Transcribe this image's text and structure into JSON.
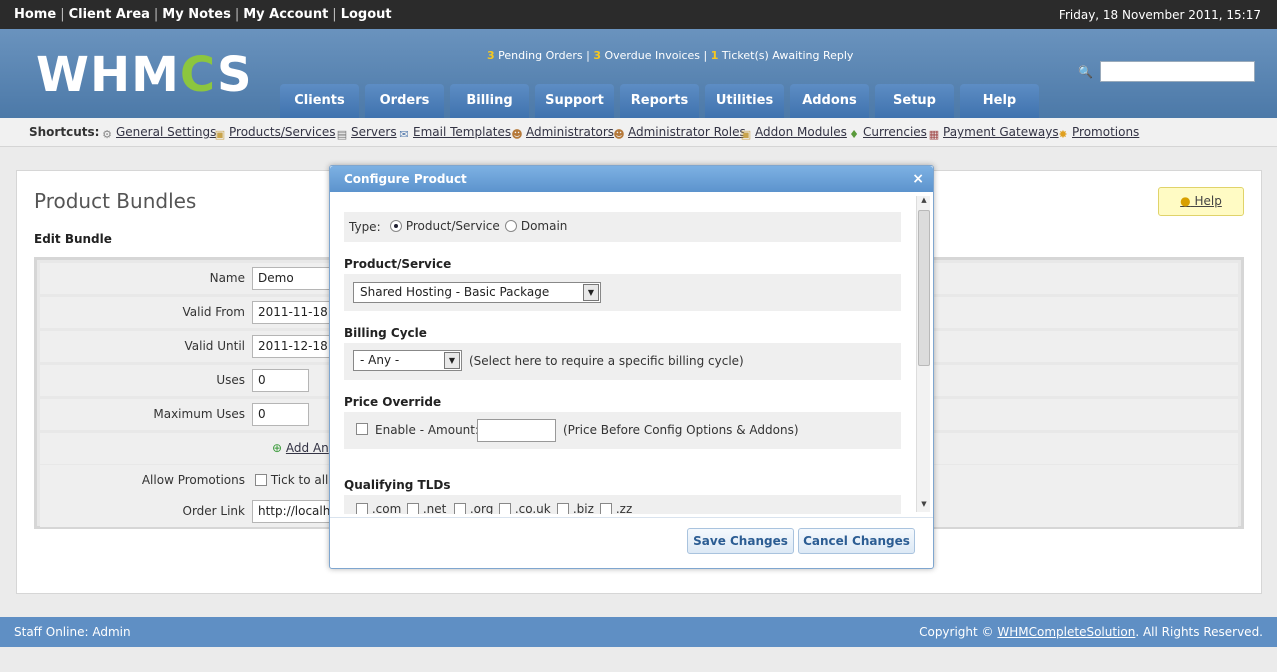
{
  "topbar": {
    "links": [
      "Home",
      "Client Area",
      "My Notes",
      "My Account",
      "Logout"
    ],
    "date": "Friday, 18 November 2011, 15:17"
  },
  "header": {
    "logo_left": "WHM",
    "logo_gear": "C",
    "logo_right": "S",
    "notices": {
      "pending_count": "3",
      "pending_label": "Pending Orders",
      "overdue_count": "3",
      "overdue_label": "Overdue Invoices",
      "tickets_count": "1",
      "tickets_label": "Ticket(s) Awaiting Reply"
    },
    "search_value": "",
    "nav": [
      "Clients",
      "Orders",
      "Billing",
      "Support",
      "Reports",
      "Utilities",
      "Addons",
      "Setup",
      "Help"
    ]
  },
  "shortcuts": {
    "label": "Shortcuts:",
    "items": [
      {
        "label": "General Settings",
        "icon": "gear-icon"
      },
      {
        "label": "Products/Services",
        "icon": "box-icon"
      },
      {
        "label": "Servers",
        "icon": "server-icon"
      },
      {
        "label": "Email Templates",
        "icon": "email-icon"
      },
      {
        "label": "Administrators",
        "icon": "user-icon"
      },
      {
        "label": "Administrator Roles",
        "icon": "user-role-icon"
      },
      {
        "label": "Addon Modules",
        "icon": "module-icon"
      },
      {
        "label": "Currencies",
        "icon": "money-icon"
      },
      {
        "label": "Payment Gateways",
        "icon": "gateway-icon"
      },
      {
        "label": "Promotions",
        "icon": "star-icon"
      }
    ]
  },
  "page": {
    "title": "Product Bundles",
    "section": "Edit Bundle",
    "help": "Help",
    "form": {
      "name_label": "Name",
      "name_value": "Demo",
      "valid_from_label": "Valid From",
      "valid_from_value": "2011-11-18",
      "valid_until_label": "Valid Until",
      "valid_until_value": "2011-12-18",
      "uses_label": "Uses",
      "uses_value": "0",
      "max_uses_label": "Maximum Uses",
      "max_uses_value": "0",
      "add_another": "Add An",
      "allow_promotions_label": "Allow Promotions",
      "allow_promotions_text": "Tick to allo",
      "order_link_label": "Order Link",
      "order_link_value": "http://localho"
    }
  },
  "modal": {
    "title": "Configure Product",
    "close": "×",
    "type_label": "Type:",
    "type_options": [
      "Product/Service",
      "Domain"
    ],
    "product_heading": "Product/Service",
    "product_value": "Shared Hosting - Basic Package",
    "billing_heading": "Billing Cycle",
    "billing_value": "- Any -",
    "billing_hint": "(Select here to require a specific billing cycle)",
    "price_heading": "Price Override",
    "price_label": "Enable - Amount:",
    "price_value": "",
    "price_hint": "(Price Before Config Options & Addons)",
    "tlds_heading": "Qualifying TLDs",
    "tlds": [
      ".com",
      ".net",
      ".org",
      ".co.uk",
      ".biz",
      ".zz"
    ],
    "save": "Save Changes",
    "cancel": "Cancel Changes"
  },
  "footer": {
    "staff": "Staff Online: Admin",
    "copyright_prefix": "Copyright ©",
    "copyright_link": "WHMCompleteSolution",
    "copyright_suffix": ". All Rights Reserved."
  }
}
